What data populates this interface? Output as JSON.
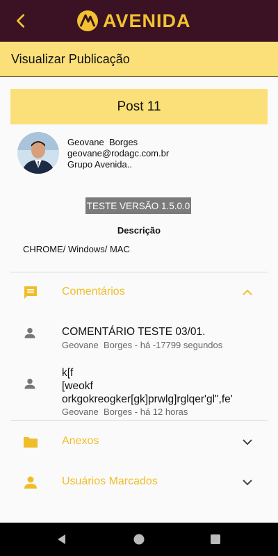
{
  "header": {
    "logo_text": "AVENIDA",
    "brand_color": "#f2c230",
    "background_color": "#3a1224"
  },
  "subheader": {
    "title": "Visualizar Publicação"
  },
  "post": {
    "title": "Post 11",
    "author_name": "Geovane  Borges",
    "author_email": "geovane@rodagc.com.br",
    "author_group": "Grupo Avenida..",
    "version_badge": "TESTE VERSÃO 1.5.0.0",
    "description_label": "Descrição",
    "description": "CHROME/ Windows/ MAC"
  },
  "sections": {
    "comments": {
      "label": "Comentários",
      "icon": "comment-icon",
      "expanded": true,
      "items": [
        {
          "text": "COMENTÁRIO TESTE 03/01.",
          "meta": "Geovane  Borges - há -17799 segundos"
        },
        {
          "text": "k[f\n[weokf\norkgokreogker[gk]prwlg]rglqer'gl\",fe'",
          "meta": "Geovane  Borges - há 12 horas"
        }
      ]
    },
    "attachments": {
      "label": "Anexos",
      "icon": "folder-icon",
      "expanded": false
    },
    "tagged_users": {
      "label": "Usuários Marcados",
      "icon": "person-icon",
      "expanded": false
    }
  },
  "accent_color": "#f0bd2a"
}
